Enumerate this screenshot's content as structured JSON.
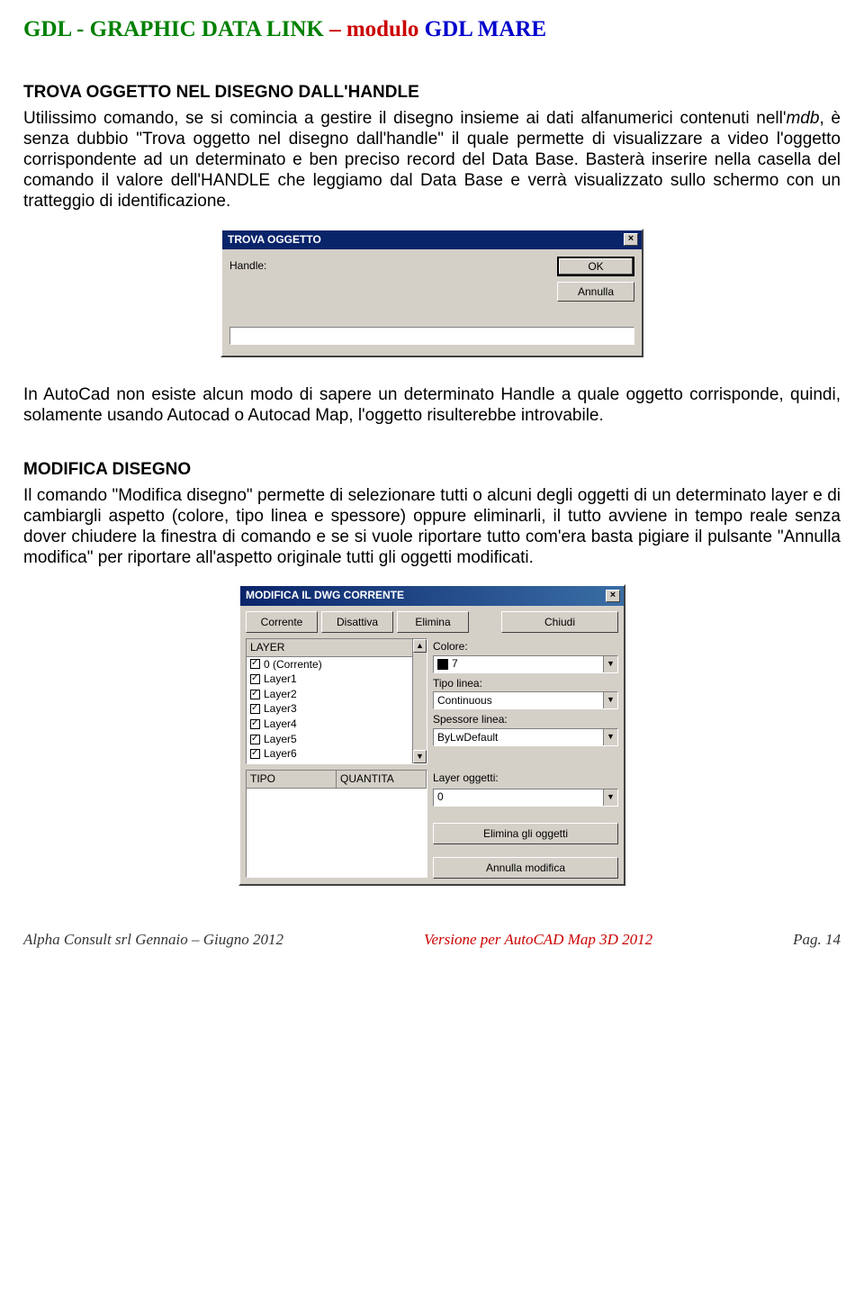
{
  "header": {
    "part1": "GDL - GRAPHIC DATA LINK",
    "part2": " – modulo ",
    "part3": "GDL MARE"
  },
  "section1": {
    "title": "TROVA OGGETTO NEL DISEGNO DALL'HANDLE",
    "text_a": "Utilissimo comando, se si comincia a gestire il disegno insieme ai dati alfanumerici contenuti nell'",
    "text_b": "mdb",
    "text_c": ", è senza dubbio \"Trova oggetto nel disegno dall'handle\" il quale permette di visualizzare a video l'oggetto corrispondente ad un determinato e ben preciso record del Data Base. Basterà inserire nella casella del comando il valore dell'HANDLE che leggiamo dal Data Base e verrà visualizzato sullo schermo con un tratteggio di identificazione."
  },
  "dlg1": {
    "title": "TROVA OGGETTO",
    "handle_label": "Handle:",
    "ok": "OK",
    "cancel": "Annulla"
  },
  "para2": "In AutoCad non esiste alcun modo di sapere un determinato Handle a quale oggetto corrisponde, quindi, solamente usando Autocad o Autocad Map, l'oggetto risulterebbe introvabile.",
  "section2": {
    "title": "MODIFICA DISEGNO",
    "text": "Il comando \"Modifica disegno\" permette di selezionare tutti o alcuni degli oggetti di un determinato layer e di cambiargli aspetto (colore, tipo linea e spessore) oppure eliminarli, il tutto avviene in tempo reale senza dover chiudere la finestra di comando e se si vuole riportare tutto com'era basta pigiare il pulsante \"Annulla modifica\" per riportare all'aspetto originale tutti gli oggetti modificati."
  },
  "dlg2": {
    "title": "MODIFICA IL DWG CORRENTE",
    "btn_corrente": "Corrente",
    "btn_disattiva": "Disattiva",
    "btn_elimina": "Elimina",
    "btn_chiudi": "Chiudi",
    "layer_header": "LAYER",
    "layers": [
      "0 (Corrente)",
      "Layer1",
      "Layer2",
      "Layer3",
      "Layer4",
      "Layer5",
      "Layer6"
    ],
    "colore_label": "Colore:",
    "colore_value": "7",
    "tipo_label": "Tipo linea:",
    "tipo_value": "Continuous",
    "spessore_label": "Spessore linea:",
    "spessore_value": "ByLwDefault",
    "tipo_col": "TIPO",
    "qty_col": "QUANTITA",
    "layerogg_label": "Layer oggetti:",
    "layerogg_value": "0",
    "btn_eliminaogg": "Elimina gli oggetti",
    "btn_annulla": "Annulla modifica"
  },
  "footer": {
    "left": "Alpha Consult srl  Gennaio – Giugno  2012",
    "mid": "Versione per AutoCAD Map 3D 2012",
    "right": "Pag. 14"
  }
}
